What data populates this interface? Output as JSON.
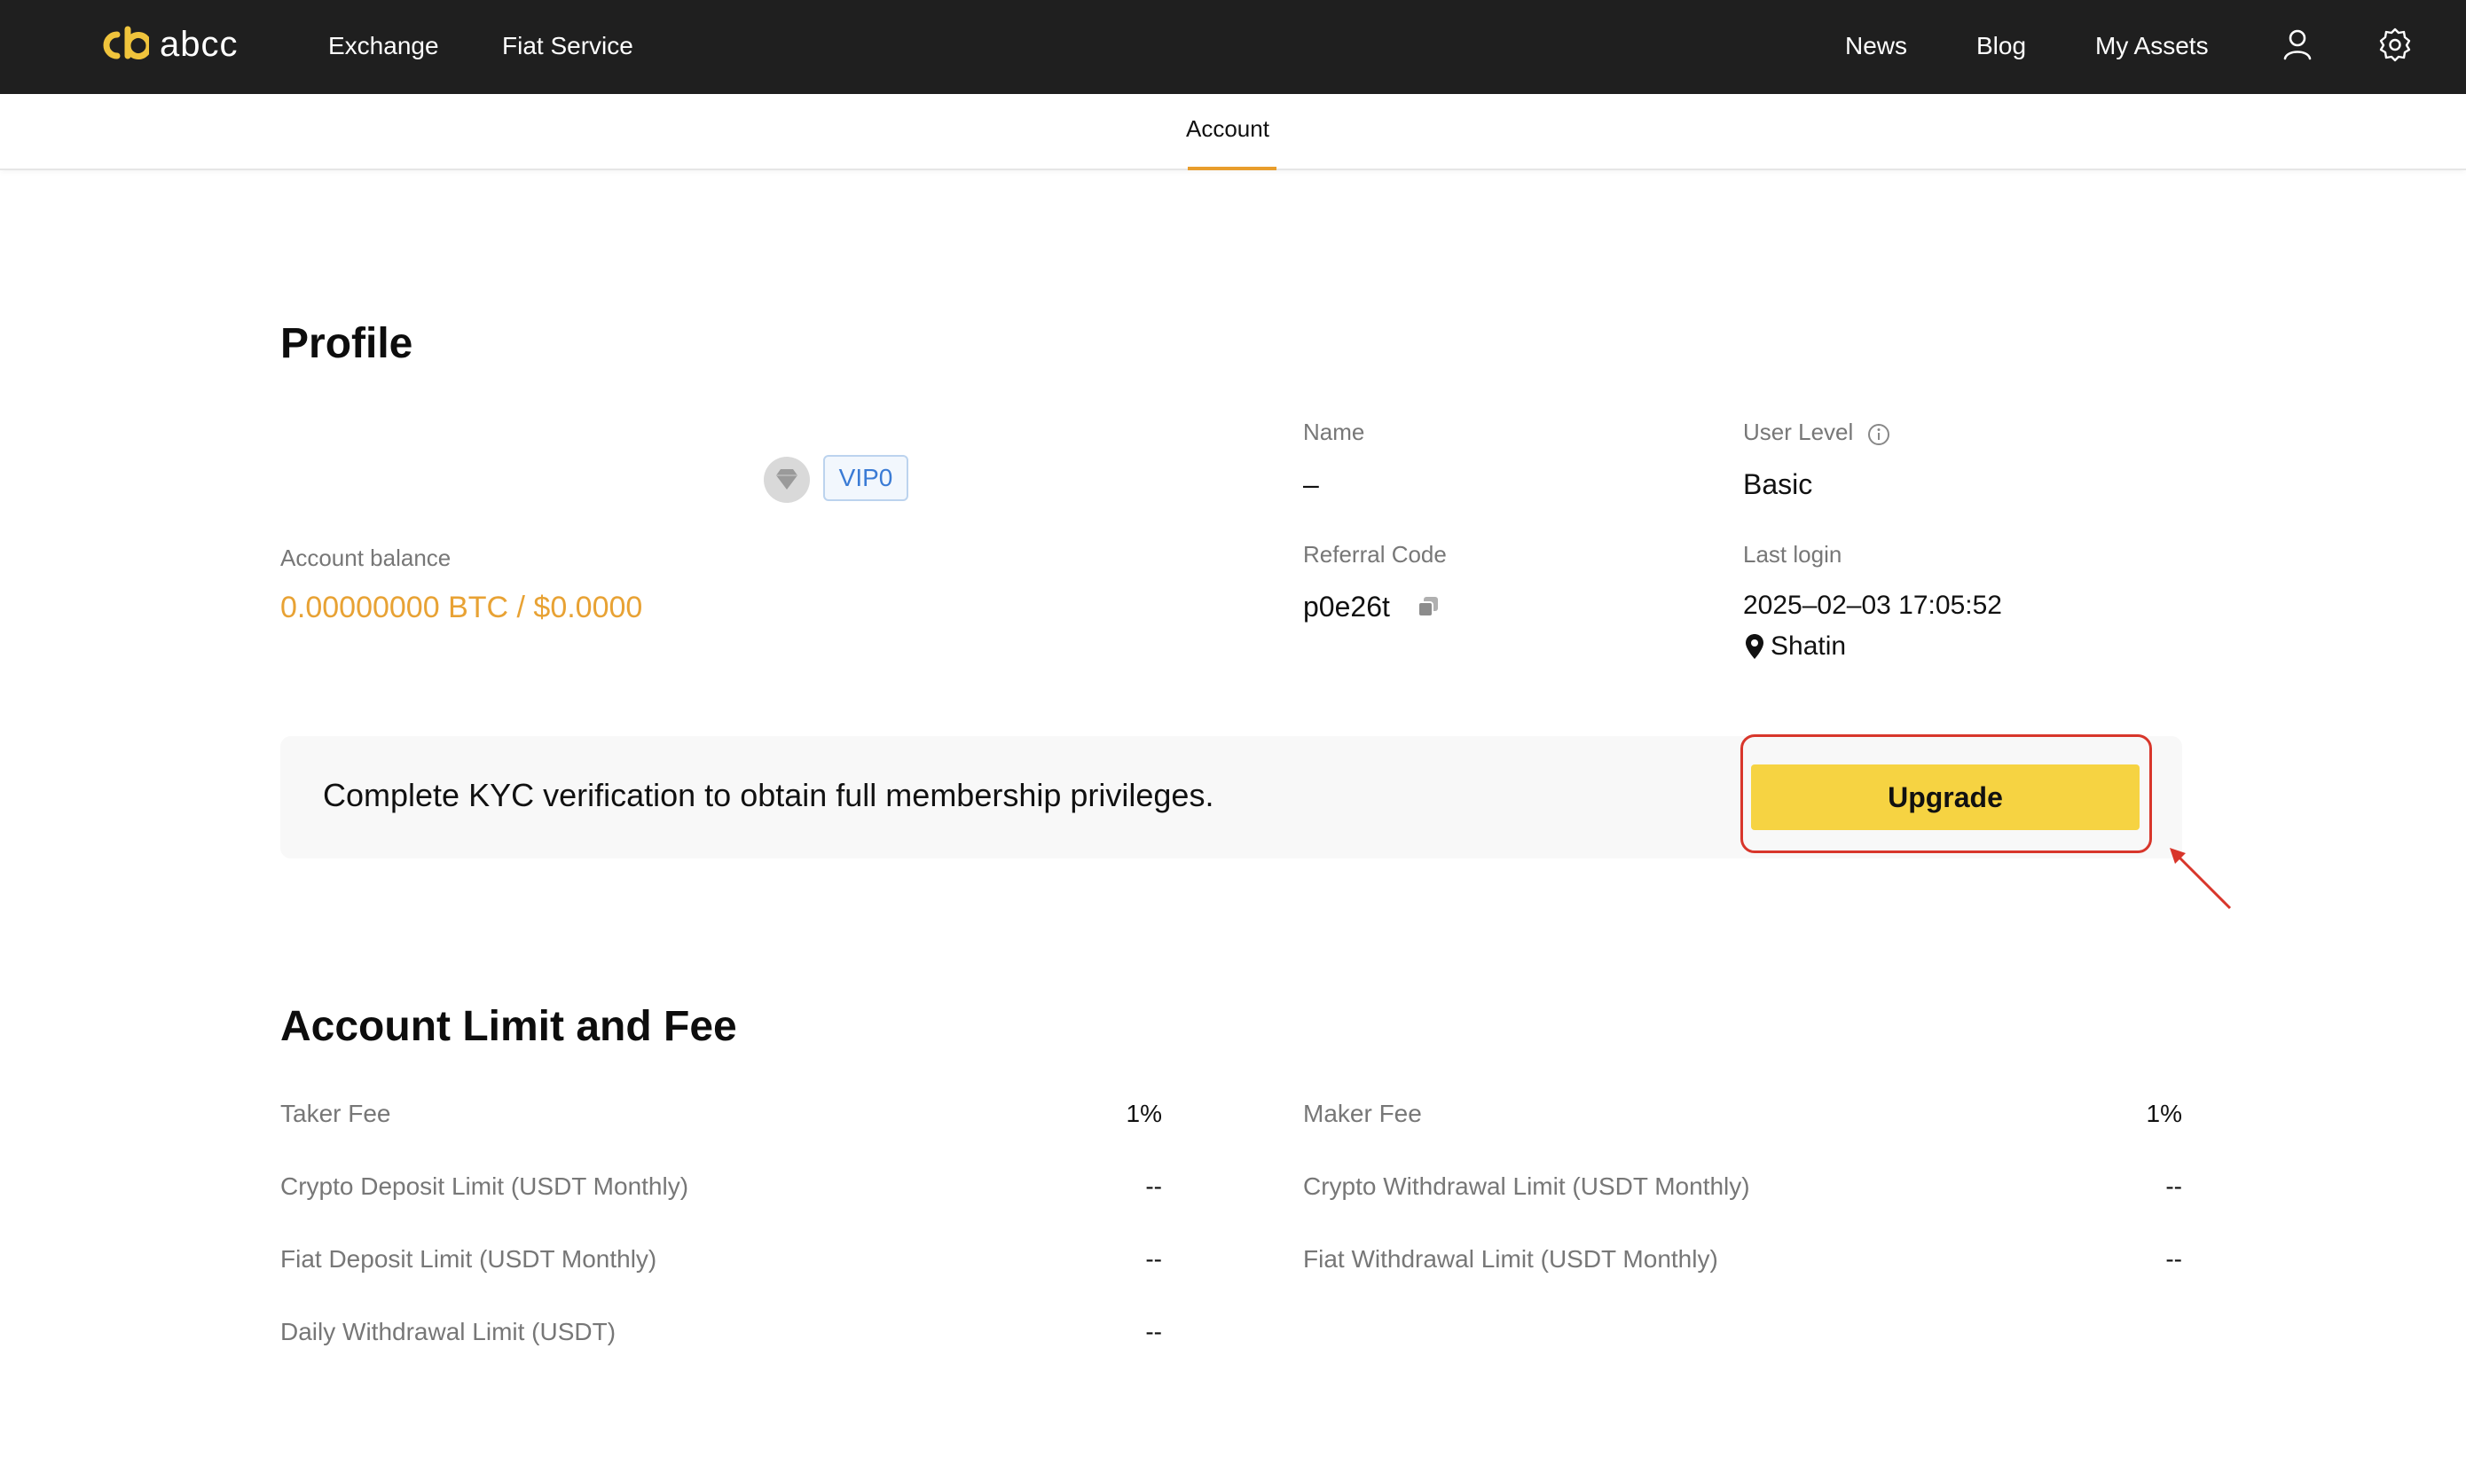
{
  "header": {
    "logo_text": "abcc",
    "nav_left": [
      "Exchange",
      "Fiat Service"
    ],
    "nav_right": [
      "News",
      "Blog",
      "My Assets"
    ],
    "icons": [
      "user-icon",
      "gear-icon"
    ]
  },
  "tabs": {
    "active": "Account"
  },
  "profile": {
    "title": "Profile",
    "vip_level": "VIP0",
    "balance_label": "Account balance",
    "balance_value": "0.00000000 BTC /  $0.0000",
    "name_label": "Name",
    "name_value": "–",
    "user_level_label": "User Level",
    "user_level_value": "Basic",
    "referral_label": "Referral Code",
    "referral_value": "p0e26t",
    "last_login_label": "Last login",
    "last_login_time": "2025–02–03 17:05:52",
    "last_login_location": "Shatin"
  },
  "kyc": {
    "message": "Complete KYC verification to obtain full membership privileges.",
    "button_label": "Upgrade"
  },
  "limits": {
    "title": "Account Limit and Fee",
    "left": [
      {
        "label": "Taker Fee",
        "value": "1%"
      },
      {
        "label": "Crypto Deposit Limit (USDT Monthly)",
        "value": "--"
      },
      {
        "label": "Fiat Deposit Limit (USDT Monthly)",
        "value": "--"
      },
      {
        "label": "Daily Withdrawal Limit (USDT)",
        "value": "--"
      }
    ],
    "right": [
      {
        "label": "Maker Fee",
        "value": "1%"
      },
      {
        "label": "Crypto Withdrawal Limit (USDT Monthly)",
        "value": "--"
      },
      {
        "label": "Fiat Withdrawal Limit (USDT Monthly)",
        "value": "--"
      }
    ]
  },
  "colors": {
    "topbar": "#1f1f1f",
    "accent_gold": "#e8a234",
    "button_yellow": "#f6d342",
    "highlight_red": "#d8362b"
  }
}
